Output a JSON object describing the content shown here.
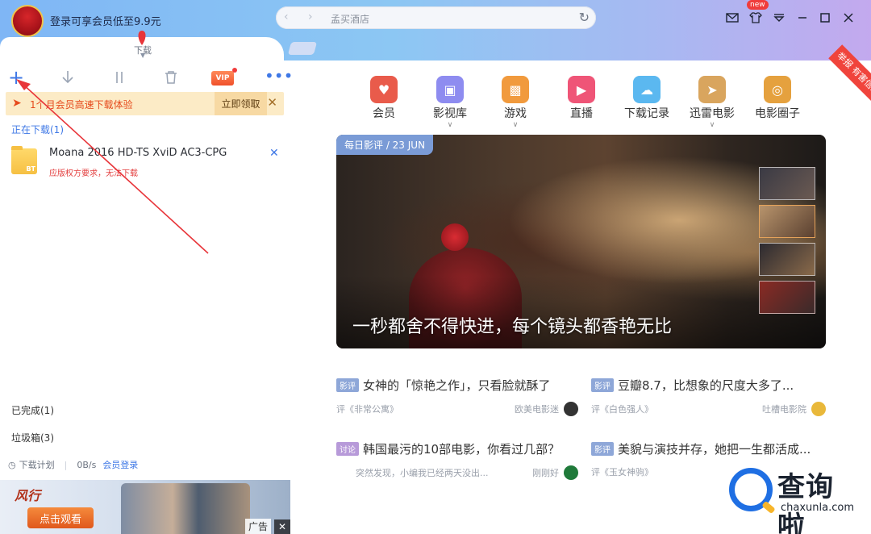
{
  "header": {
    "login_promo": "登录可享会员低至9.9元",
    "address": "孟买酒店",
    "new_badge": "new",
    "tab_download": "下载"
  },
  "toolbar": {
    "add_icon": "plus-icon",
    "download_icon": "download-icon",
    "pause_icon": "pause-icon",
    "delete_icon": "trash-icon",
    "vip_label": "VIP",
    "more_icon": "more-icon"
  },
  "promo": {
    "text": "1个月会员高速下载体验",
    "button": "立即领取"
  },
  "downloads": {
    "downloading_title": "正在下载(1)",
    "file": {
      "name": "Moana 2016 HD-TS XviD AC3-CPG",
      "type": "BT",
      "error": "应版权方要求，无法下载"
    },
    "completed": "已完成(1)",
    "trash": "垃圾箱(3)"
  },
  "status_bar": {
    "plan": "下载计划",
    "speed": "0B/s",
    "member_login": "会员登录"
  },
  "ad": {
    "brand": "风行",
    "cta": "点击观看",
    "tag": "广告"
  },
  "categories": [
    {
      "label": "会员",
      "color": "#e95b4b",
      "icon": "heart-icon",
      "dropdown": false
    },
    {
      "label": "影视库",
      "color": "#8e8cf0",
      "icon": "film-icon",
      "dropdown": true
    },
    {
      "label": "游戏",
      "color": "#f19a3d",
      "icon": "gamepad-icon",
      "dropdown": true
    },
    {
      "label": "直播",
      "color": "#ef5577",
      "icon": "play-icon",
      "dropdown": false
    },
    {
      "label": "下载记录",
      "color": "#5bb8f0",
      "icon": "cloud-icon",
      "dropdown": false
    },
    {
      "label": "迅雷电影",
      "color": "#d9a55e",
      "icon": "bird-icon",
      "dropdown": true
    },
    {
      "label": "电影圈子",
      "color": "#e5a13e",
      "icon": "circle-icon",
      "dropdown": false
    }
  ],
  "hero": {
    "tag": "每日影评 / 23 JUN",
    "title": "一秒都舍不得快进，每个镜头都香艳无比"
  },
  "news": [
    {
      "tag": "影评",
      "headline": "女神的「惊艳之作」，只看脸就酥了",
      "left": "评《非常公寓》",
      "source": "欧美电影迷",
      "logo_color": "#333333"
    },
    {
      "tag": "影评",
      "headline": "豆瓣8.7，比想象的尺度大多了...",
      "left": "评《白色强人》",
      "source": "吐槽电影院",
      "logo_color": "#e9b83a"
    },
    {
      "tag": "讨论",
      "headline": "韩国最污的10部电影，你看过几部？",
      "left": "突然发现，小编我已经两天没出...",
      "source": "刚刚好",
      "logo_color": "#1f7a3a"
    },
    {
      "tag": "影评",
      "headline": "美貌与演技并存，她把一生都活成...",
      "left": "评《玉女神驹》",
      "source": "",
      "logo_color": ""
    }
  ],
  "report": "举报 有害信息",
  "watermark": {
    "text": "查询啦",
    "domain": "chaxunla.com"
  }
}
